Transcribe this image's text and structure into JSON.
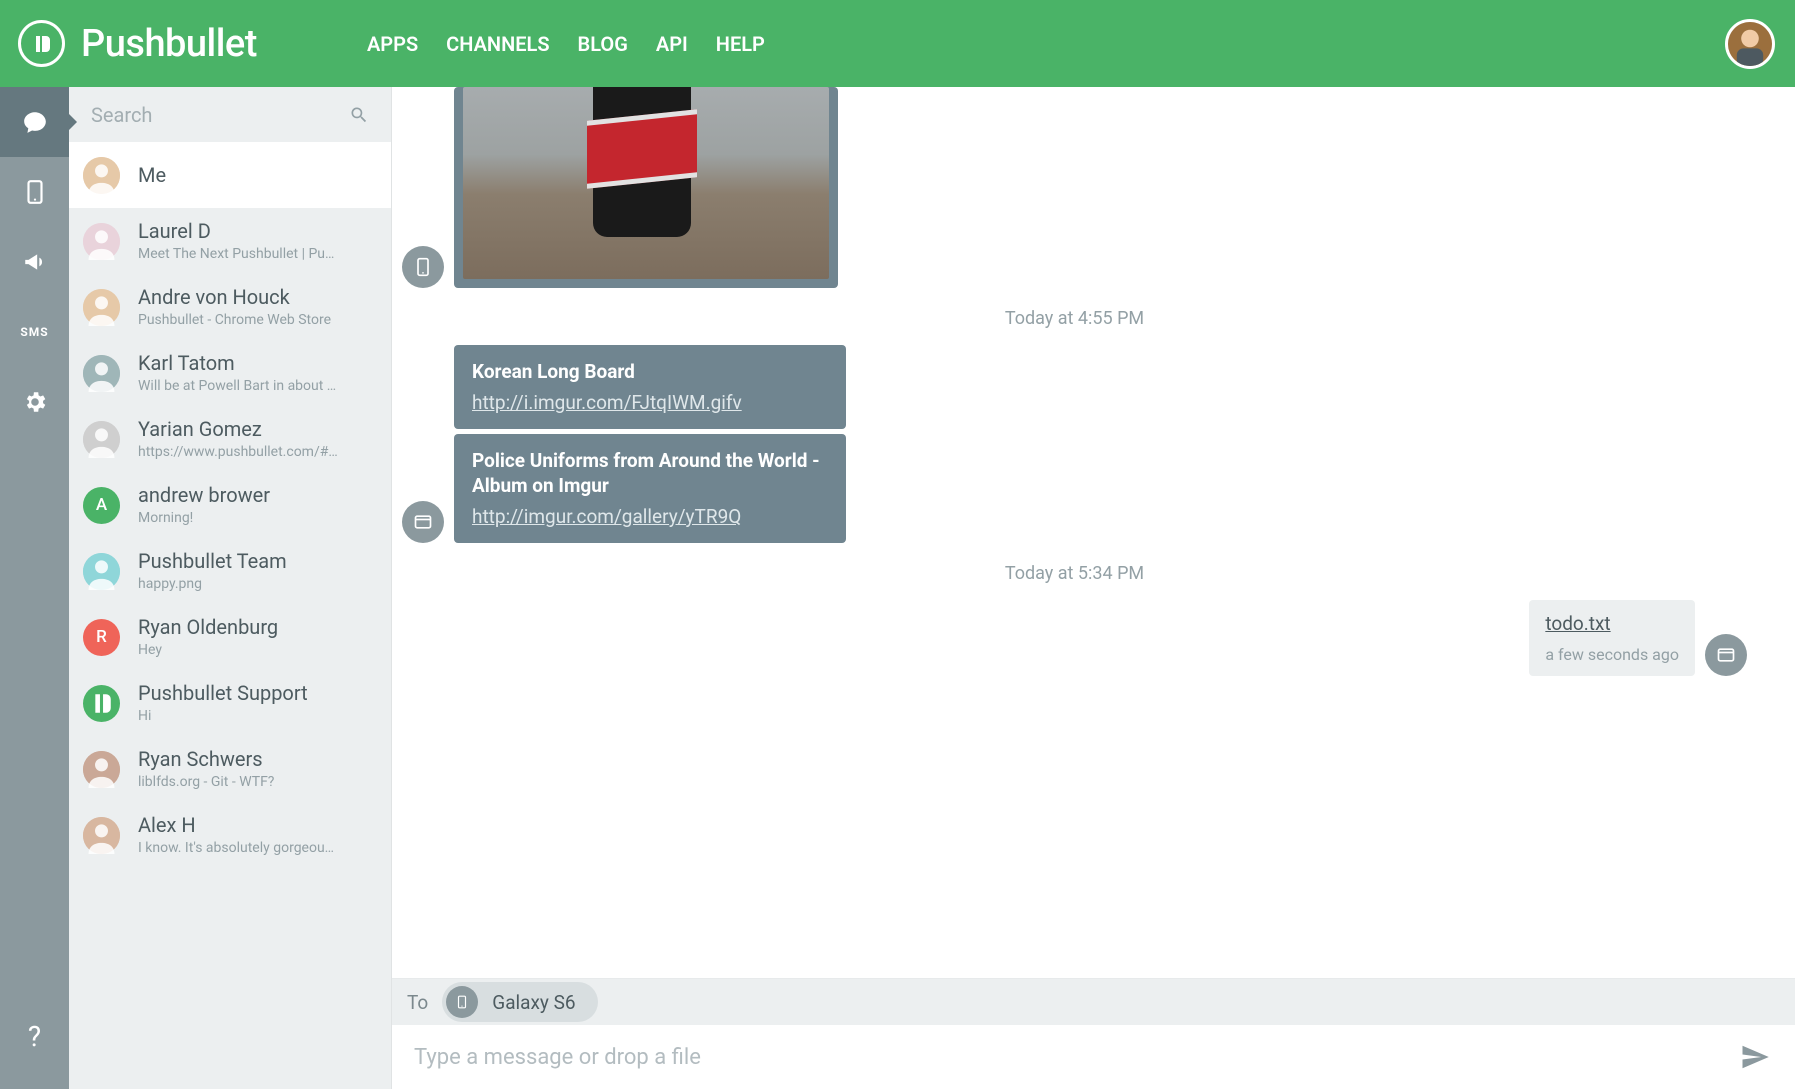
{
  "brand": "Pushbullet",
  "nav": {
    "apps": "APPS",
    "channels": "CHANNELS",
    "blog": "BLOG",
    "api": "API",
    "help": "HELP"
  },
  "rail": {
    "sms": "SMS",
    "help": "?"
  },
  "search": {
    "placeholder": "Search"
  },
  "conversations": [
    {
      "name": "Me",
      "sub": "",
      "av_bg": "",
      "av_type": "face",
      "hue": "#e6c9a8"
    },
    {
      "name": "Laurel D",
      "sub": "Meet The Next Pushbullet | Pu…",
      "av_type": "face",
      "hue": "#e9d3db"
    },
    {
      "name": "Andre von Houck",
      "sub": "Pushbullet - Chrome Web Store",
      "av_type": "face",
      "hue": "#e6c9a8"
    },
    {
      "name": "Karl Tatom",
      "sub": "Will be at Powell Bart in about …",
      "av_type": "face",
      "hue": "#9fb6b8"
    },
    {
      "name": "Yarian Gomez",
      "sub": "https://www.pushbullet.com/#…",
      "av_type": "face",
      "hue": "#cfcfcf"
    },
    {
      "name": "andrew brower",
      "sub": "Morning!",
      "av_type": "letter",
      "letter": "A",
      "hue": "#4ab367"
    },
    {
      "name": "Pushbullet Team",
      "sub": "happy.png",
      "av_type": "icon",
      "hue": "#8fd6d9"
    },
    {
      "name": "Ryan Oldenburg",
      "sub": "Hey",
      "av_type": "letter",
      "letter": "R",
      "hue": "#ef6459"
    },
    {
      "name": "Pushbullet Support",
      "sub": "Hi",
      "av_type": "logo",
      "hue": "#4ab367"
    },
    {
      "name": "Ryan Schwers",
      "sub": "liblfds.org - Git - WTF?",
      "av_type": "face",
      "hue": "#caa897"
    },
    {
      "name": "Alex H",
      "sub": "I know. It's absolutely gorgeou…",
      "av_type": "face",
      "hue": "#d8b7a0"
    }
  ],
  "messages": {
    "ts1": "Today at 4:55 PM",
    "ts2": "Today at 5:34 PM",
    "m1_title": "Korean Long Board",
    "m1_url": "http://i.imgur.com/FJtqIWM.gifv",
    "m2_title": "Police Uniforms from Around the World - Album on Imgur",
    "m2_url": "http://imgur.com/gallery/yTR9Q",
    "out_file": "todo.txt",
    "out_meta": "a few seconds ago"
  },
  "composer": {
    "to_label": "To",
    "chip_label": "Galaxy S6",
    "placeholder": "Type a message or drop a file"
  }
}
